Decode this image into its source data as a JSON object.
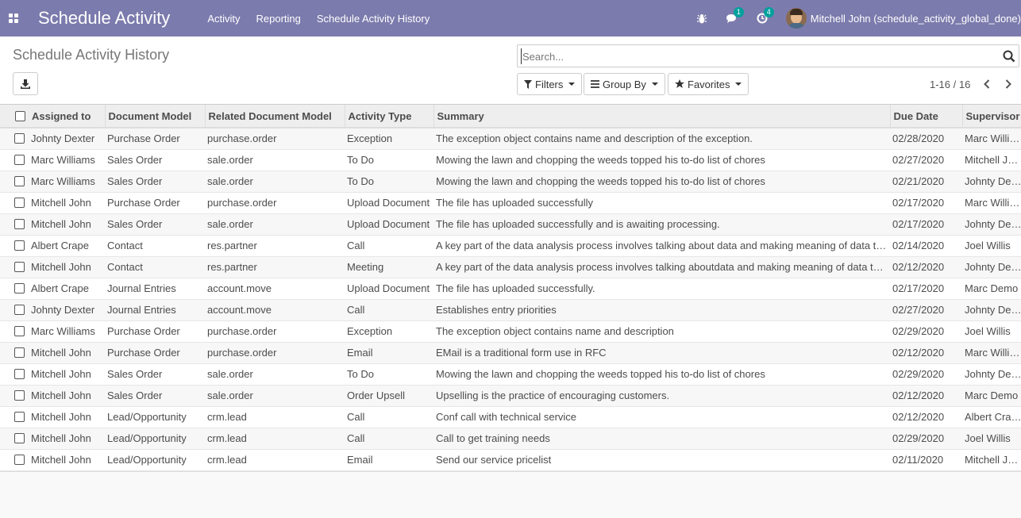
{
  "app": {
    "title": "Schedule Activity",
    "menu": [
      "Activity",
      "Reporting",
      "Schedule Activity History"
    ],
    "messages_count": "1",
    "activities_count": "4",
    "user_name": "Mitchell John (schedule_activity_global_done)"
  },
  "page": {
    "title": "Schedule Activity History",
    "search_placeholder": "Search...",
    "filters_label": "Filters",
    "group_by_label": "Group By",
    "favorites_label": "Favorites",
    "pager_text": "1-16 / 16"
  },
  "table": {
    "columns": [
      "Assigned to",
      "Document Model",
      "Related Document Model",
      "Activity Type",
      "Summary",
      "Due Date",
      "Supervisor"
    ],
    "rows": [
      [
        "Johnty Dexter",
        "Purchase Order",
        "purchase.order",
        "Exception",
        "The exception object contains name and description of the exception.",
        "02/28/2020",
        "Marc Williams"
      ],
      [
        "Marc Williams",
        "Sales Order",
        "sale.order",
        "To Do",
        "Mowing the lawn and chopping the weeds topped his to-do list of chores",
        "02/27/2020",
        "Mitchell John"
      ],
      [
        "Marc Williams",
        "Sales Order",
        "sale.order",
        "To Do",
        "Mowing the lawn and chopping the weeds topped his to-do list of chores",
        "02/21/2020",
        "Johnty Dexter"
      ],
      [
        "Mitchell John",
        "Purchase Order",
        "purchase.order",
        "Upload Document",
        "The file has uploaded successfully",
        "02/17/2020",
        "Marc Williams"
      ],
      [
        "Mitchell John",
        "Sales Order",
        "sale.order",
        "Upload Document",
        "The file has uploaded successfully and is awaiting processing.",
        "02/17/2020",
        "Johnty Dexter"
      ],
      [
        "Albert Crape",
        "Contact",
        "res.partner",
        "Call",
        "A key part of the data analysis process involves talking about data and making meaning of data to gain insight.",
        "02/14/2020",
        "Joel Willis"
      ],
      [
        "Mitchell John",
        "Contact",
        "res.partner",
        "Meeting",
        "A key part of the data analysis process involves talking aboutdata and making meaning of data to gain insight.",
        "02/12/2020",
        "Johnty Dexter"
      ],
      [
        "Albert Crape",
        "Journal Entries",
        "account.move",
        "Upload Document",
        "The file has uploaded successfully.",
        "02/17/2020",
        "Marc Demo"
      ],
      [
        "Johnty Dexter",
        "Journal Entries",
        "account.move",
        "Call",
        "Establishes entry priorities",
        "02/27/2020",
        "Johnty Dexter"
      ],
      [
        "Marc Williams",
        "Purchase Order",
        "purchase.order",
        "Exception",
        "The exception object contains name and description",
        "02/29/2020",
        "Joel Willis"
      ],
      [
        "Mitchell John",
        "Purchase Order",
        "purchase.order",
        "Email",
        "EMail is a traditional form use in RFC",
        "02/12/2020",
        "Marc Williams"
      ],
      [
        "Mitchell John",
        "Sales Order",
        "sale.order",
        "To Do",
        "Mowing the lawn and chopping the weeds topped his to-do list of chores",
        "02/29/2020",
        "Johnty Dexter"
      ],
      [
        "Mitchell John",
        "Sales Order",
        "sale.order",
        "Order Upsell",
        "Upselling is the practice of encouraging customers.",
        "02/12/2020",
        "Marc Demo"
      ],
      [
        "Mitchell John",
        "Lead/Opportunity",
        "crm.lead",
        "Call",
        "Conf call with technical service",
        "02/12/2020",
        "Albert Crape"
      ],
      [
        "Mitchell John",
        "Lead/Opportunity",
        "crm.lead",
        "Call",
        "Call to get training needs",
        "02/29/2020",
        "Joel Willis"
      ],
      [
        "Mitchell John",
        "Lead/Opportunity",
        "crm.lead",
        "Email",
        "Send our service pricelist",
        "02/11/2020",
        "Mitchell John"
      ]
    ]
  }
}
